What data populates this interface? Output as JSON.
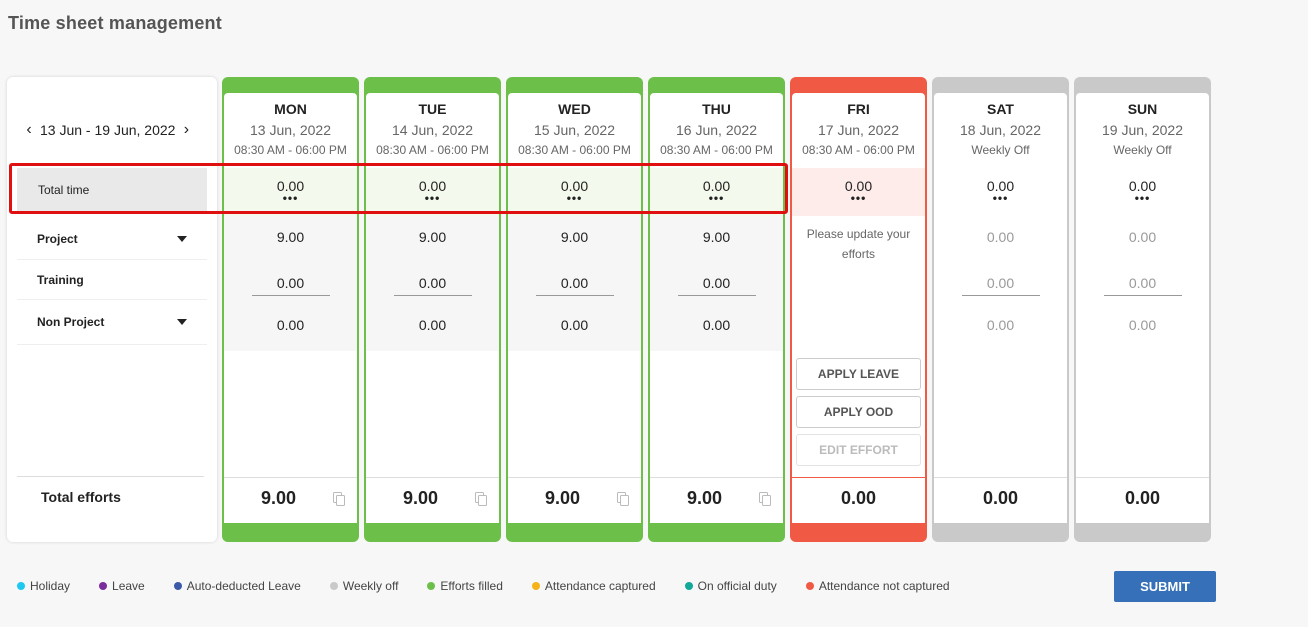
{
  "page_title": "Time sheet management",
  "week_nav": {
    "prev": "‹",
    "range": "13 Jun - 19 Jun, 2022",
    "next": "›"
  },
  "rows": {
    "total_time": "Total time",
    "project": "Project",
    "training": "Training",
    "non_project": "Non Project",
    "total_efforts": "Total efforts"
  },
  "days": [
    {
      "name": "MON",
      "date": "13 Jun, 2022",
      "shift": "08:30 AM - 06:00 PM",
      "total": "0.00",
      "dots": "•••",
      "project": "9.00",
      "training": "0.00",
      "non_project": "0.00",
      "efforts": "9.00"
    },
    {
      "name": "TUE",
      "date": "14 Jun, 2022",
      "shift": "08:30 AM - 06:00 PM",
      "total": "0.00",
      "dots": "•••",
      "project": "9.00",
      "training": "0.00",
      "non_project": "0.00",
      "efforts": "9.00"
    },
    {
      "name": "WED",
      "date": "15 Jun, 2022",
      "shift": "08:30 AM - 06:00 PM",
      "total": "0.00",
      "dots": "•••",
      "project": "9.00",
      "training": "0.00",
      "non_project": "0.00",
      "efforts": "9.00"
    },
    {
      "name": "THU",
      "date": "16 Jun, 2022",
      "shift": "08:30 AM - 06:00 PM",
      "total": "0.00",
      "dots": "•••",
      "project": "9.00",
      "training": "0.00",
      "non_project": "0.00",
      "efforts": "9.00"
    },
    {
      "name": "FRI",
      "date": "17 Jun, 2022",
      "shift": "08:30 AM - 06:00 PM",
      "total": "0.00",
      "dots": "•••",
      "message": "Please update your efforts",
      "apply_leave": "APPLY LEAVE",
      "apply_ood": "APPLY OOD",
      "edit_effort": "EDIT EFFORT",
      "efforts": "0.00"
    },
    {
      "name": "SAT",
      "date": "18 Jun, 2022",
      "shift": "Weekly Off",
      "total": "0.00",
      "dots": "•••",
      "project": "0.00",
      "training": "0.00",
      "non_project": "0.00",
      "efforts": "0.00"
    },
    {
      "name": "SUN",
      "date": "19 Jun, 2022",
      "shift": "Weekly Off",
      "total": "0.00",
      "dots": "•••",
      "project": "0.00",
      "training": "0.00",
      "non_project": "0.00",
      "efforts": "0.00"
    }
  ],
  "legend": [
    {
      "label": "Holiday",
      "color": "#1ec8f0"
    },
    {
      "label": "Leave",
      "color": "#7b2d9c"
    },
    {
      "label": "Auto-deducted Leave",
      "color": "#3d5aa8"
    },
    {
      "label": "Weekly off",
      "color": "#c9c9c9"
    },
    {
      "label": "Efforts filled",
      "color": "#6cc04a"
    },
    {
      "label": "Attendance captured",
      "color": "#f5b21b"
    },
    {
      "label": "On official duty",
      "color": "#12a89a"
    },
    {
      "label": "Attendance not captured",
      "color": "#f05a45"
    }
  ],
  "submit_label": "SUBMIT",
  "colors": {
    "filled": "#6cc04a",
    "not_captured": "#f05a45",
    "weekly_off": "#c9c9c9",
    "submit": "#3570b8",
    "highlight": "#e01010"
  }
}
